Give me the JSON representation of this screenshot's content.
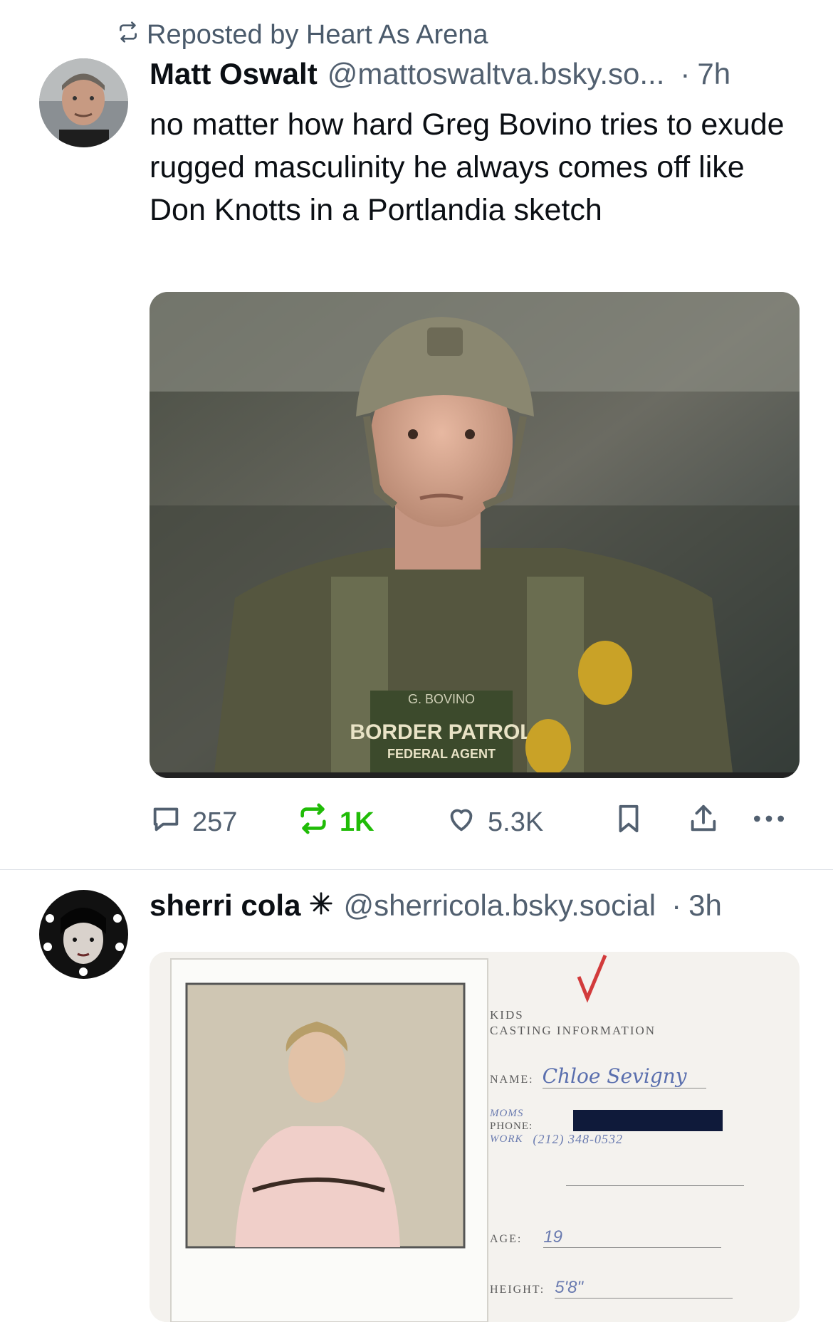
{
  "repost": {
    "text": "Reposted by Heart As Arena"
  },
  "post1": {
    "author": "Matt Oswalt",
    "handle": "@mattoswaltva.bsky.so...",
    "separator": "·",
    "time": "7h",
    "text": "no matter how hard Greg Bovino tries to exude rugged masculinity he always comes off like Don Knotts in a Portlandia sketch",
    "image": {
      "name_tag": "G. BOVINO",
      "patch_line1": "BORDER PATROL",
      "patch_line2": "FEDERAL AGENT"
    },
    "actions": {
      "replies": "257",
      "reposts": "1K",
      "likes": "5.3K"
    }
  },
  "post2": {
    "author": "sherri cola",
    "handle": "@sherricola.bsky.social",
    "separator": "·",
    "time": "3h",
    "card": {
      "heading1": "KIDS",
      "heading2": "CASTING INFORMATION",
      "name_label": "NAME:",
      "name_value": "Chloe Sevigny",
      "moms_label": "MOMS",
      "phone_label": "PHONE:",
      "work_label": "WORK",
      "work_value": "(212) 348-0532",
      "age_label": "AGE:",
      "age_value": "19",
      "height_label": "HEIGHT:",
      "height_value": "5'8\""
    }
  },
  "colors": {
    "accent_repost": "#20bc07",
    "muted": "#526070",
    "text": "#0b0f14"
  }
}
